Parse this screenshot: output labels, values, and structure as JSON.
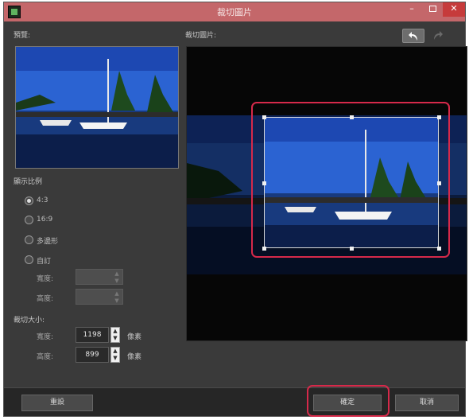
{
  "window": {
    "title": "裁切圖片"
  },
  "labels": {
    "preview": "預覽:",
    "crop_image": "裁切圖片:"
  },
  "toolbar": {
    "undo_icon": "undo-arrow-icon",
    "redo_icon": "redo-arrow-icon"
  },
  "aspect": {
    "label": "顯示比例",
    "options": [
      {
        "label": "4:3",
        "selected": true
      },
      {
        "label": "16:9",
        "selected": false
      },
      {
        "label": "多邊形",
        "selected": false
      },
      {
        "label": "自訂",
        "selected": false
      }
    ],
    "custom": {
      "width_label": "寬度:",
      "height_label": "高度:"
    }
  },
  "crop_size": {
    "label": "裁切大小:",
    "width_label": "寬度:",
    "width_value": "1198",
    "height_label": "高度:",
    "height_value": "899",
    "unit": "像素"
  },
  "buttons": {
    "reset": "重設",
    "ok": "確定",
    "cancel": "取消"
  },
  "colors": {
    "titlebar": "#c4676a",
    "highlight": "#d6294a",
    "panel": "#3a3a3a"
  }
}
